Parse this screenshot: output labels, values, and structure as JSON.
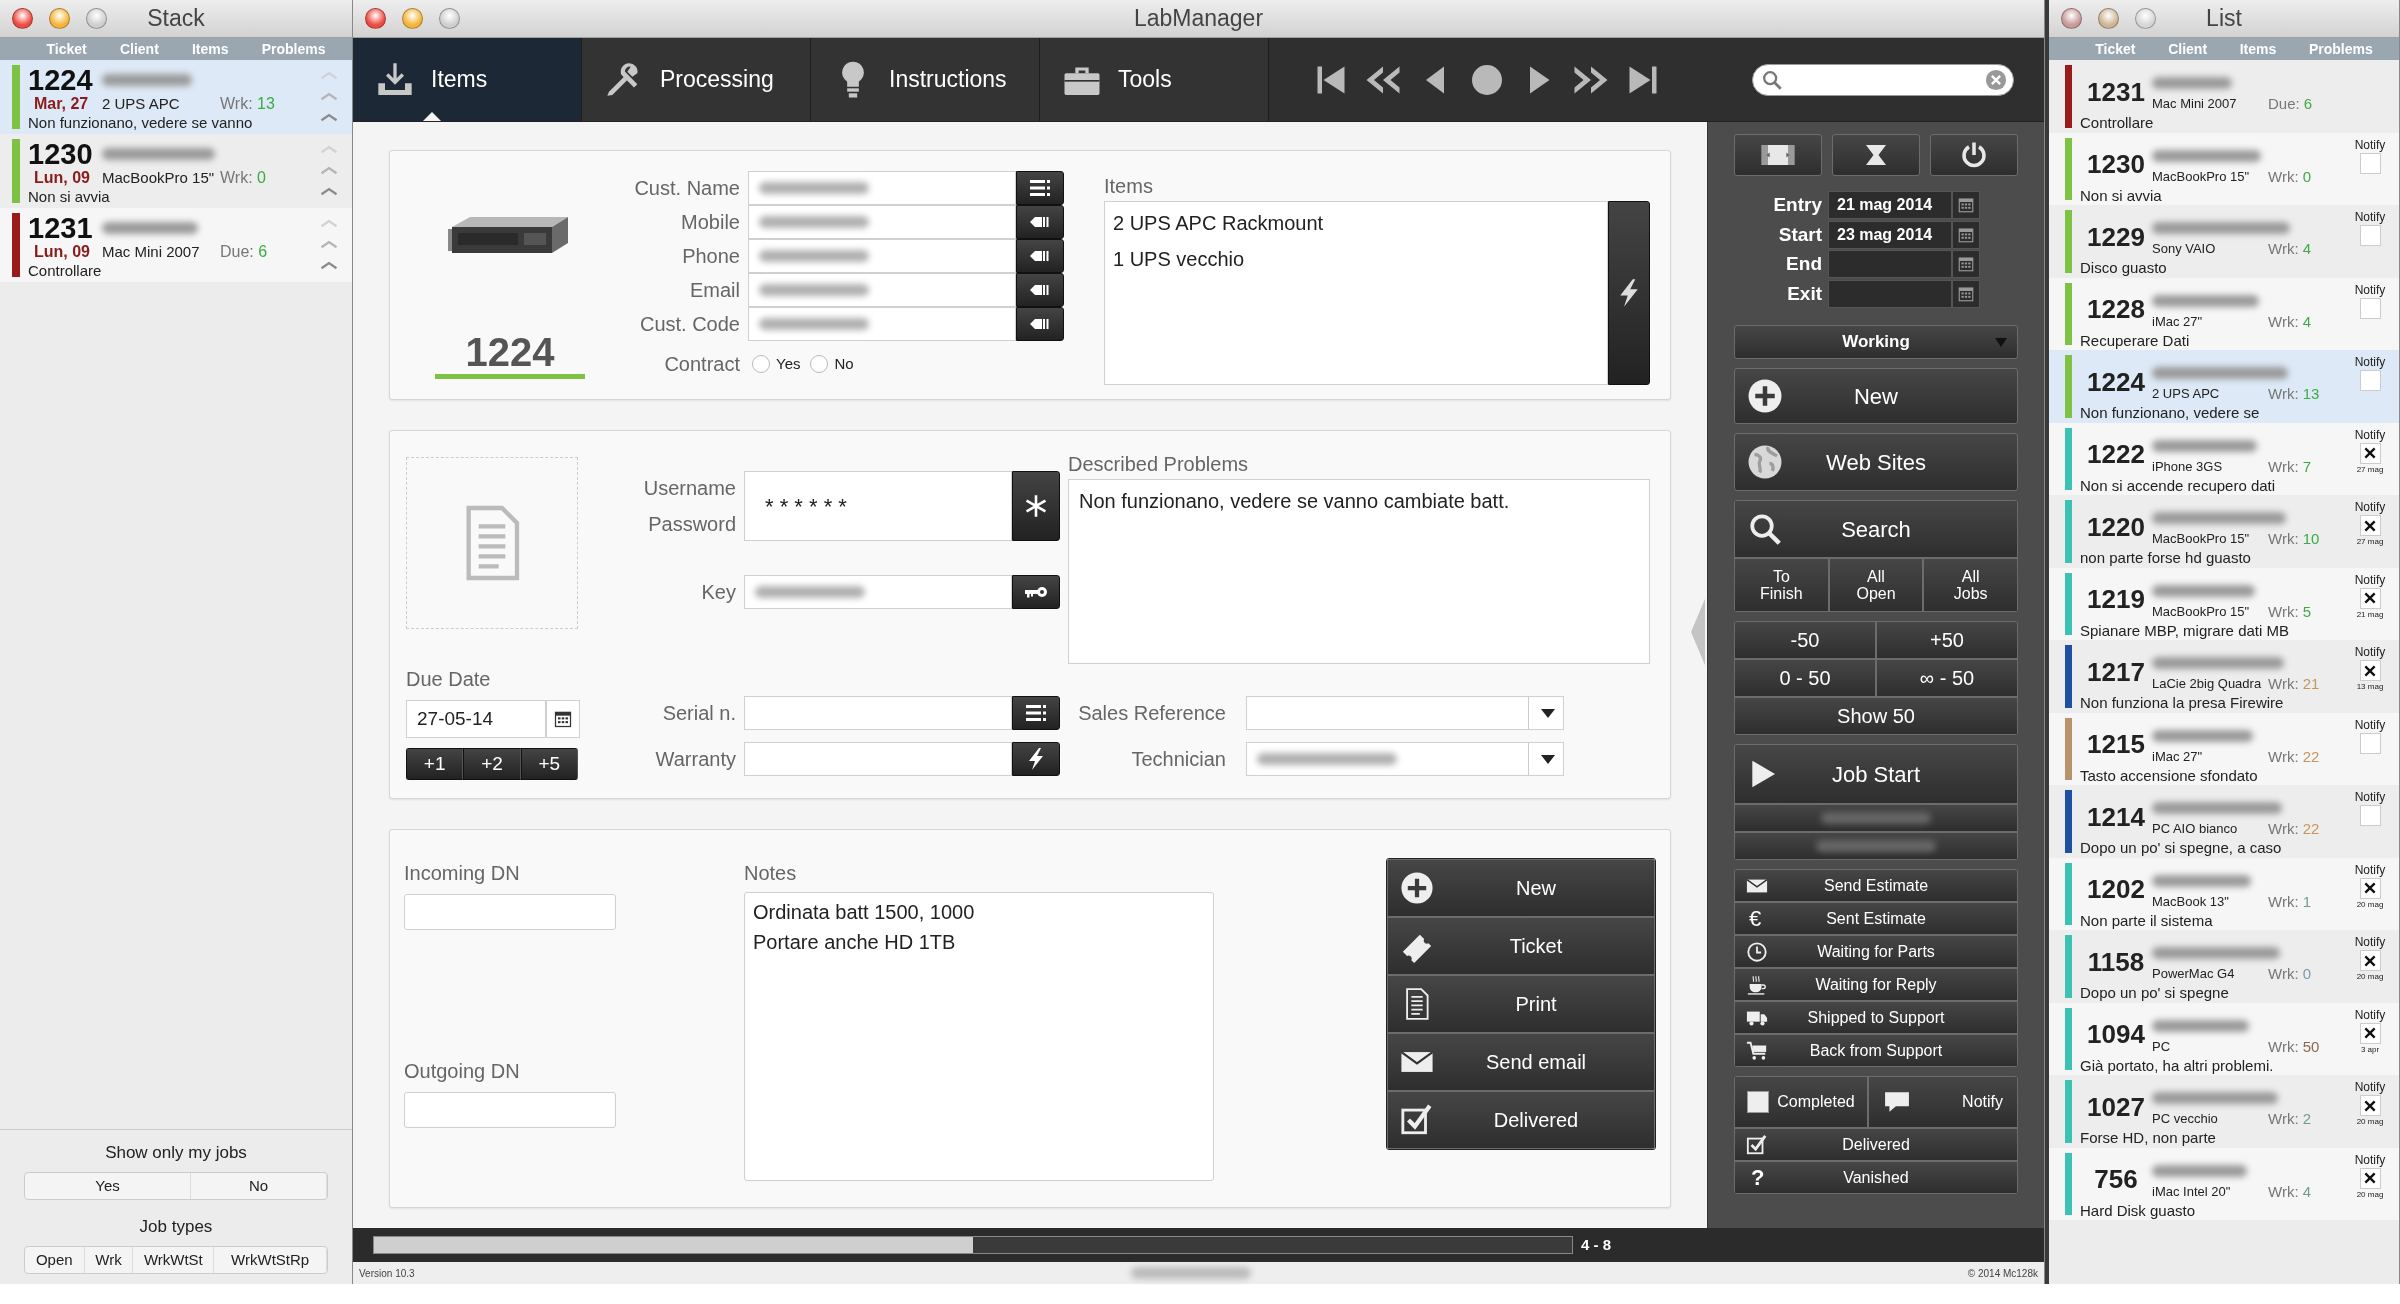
{
  "stack": {
    "title": "Stack",
    "columns": [
      "Ticket",
      "Client",
      "Items",
      "Problems"
    ],
    "rows": [
      {
        "ticket": "1224",
        "date": "Mar, 27",
        "client_redacted": true,
        "item": "2 UPS APC",
        "counter": {
          "label": "Wrk:",
          "value": "13",
          "color": "#3daa45"
        },
        "problem": "Non funzionano, vedere se vanno",
        "color": "#7dc242",
        "selected": true
      },
      {
        "ticket": "1230",
        "date": "Lun, 09",
        "client_redacted": true,
        "item": "MacBookPro 15\"",
        "counter": {
          "label": "Wrk:",
          "value": "0",
          "color": "#3daa45"
        },
        "problem": "Non si avvia",
        "color": "#7dc242",
        "selected": false
      },
      {
        "ticket": "1231",
        "date": "Lun, 09",
        "client_redacted": true,
        "item": "Mac Mini 2007",
        "counter": {
          "label": "Due:",
          "value": "6",
          "color": "#3daa45"
        },
        "problem": "Controllare",
        "color": "#9b1b1b",
        "selected": false
      }
    ],
    "my_jobs": {
      "label": "Show only my jobs",
      "options": [
        {
          "label": "Yes",
          "selected": false
        },
        {
          "label": "No",
          "selected": false
        }
      ]
    },
    "job_types": {
      "label": "Job types",
      "options": [
        {
          "label": "Open",
          "selected": false
        },
        {
          "label": "Wrk",
          "selected": false
        },
        {
          "label": "WrkWtSt",
          "selected": false
        },
        {
          "label": "WrkWtStRp",
          "selected": false
        }
      ]
    }
  },
  "main": {
    "title": "LabManager",
    "tabs": [
      {
        "label": "Items",
        "selected": true
      },
      {
        "label": "Processing",
        "selected": false
      },
      {
        "label": "Instructions",
        "selected": false
      },
      {
        "label": "Tools",
        "selected": false
      }
    ],
    "ticket": {
      "number": "1224",
      "color": "#7dc242"
    },
    "customer_fields": [
      {
        "label": "Cust. Name",
        "redacted": true
      },
      {
        "label": "Mobile",
        "redacted": true
      },
      {
        "label": "Phone",
        "redacted": true
      },
      {
        "label": "Email",
        "redacted": true
      },
      {
        "label": "Cust. Code",
        "redacted": true
      }
    ],
    "contract": {
      "label": "Contract",
      "options": [
        {
          "label": "Yes",
          "selected": false
        },
        {
          "label": "No",
          "selected": false
        }
      ]
    },
    "items": {
      "label": "Items",
      "lines": [
        "2 UPS APC Rackmount",
        "1 UPS vecchio"
      ]
    },
    "due_date": {
      "label": "Due Date",
      "value": "27-05-14",
      "increments": [
        "+1",
        "+2",
        "+5"
      ]
    },
    "credentials": {
      "labels": [
        "Username",
        "Password"
      ],
      "value": "* * * * * *"
    },
    "key": {
      "label": "Key",
      "redacted": true
    },
    "serial": {
      "label": "Serial n."
    },
    "warranty": {
      "label": "Warranty"
    },
    "described_problems": {
      "label": "Described Problems",
      "text": "Non funzionano, vedere se vanno cambiate batt."
    },
    "sales_reference": {
      "label": "Sales Reference"
    },
    "technician": {
      "label": "Technician",
      "redacted": true
    },
    "incoming_dn": {
      "label": "Incoming DN"
    },
    "outgoing_dn": {
      "label": "Outgoing DN"
    },
    "notes": {
      "label": "Notes",
      "lines": [
        "Ordinata batt 1500, 1000",
        "Portare anche HD 1TB"
      ]
    },
    "actions": [
      "New",
      "Ticket",
      "Print",
      "Send email",
      "Delivered"
    ],
    "dates": [
      {
        "label": "Entry",
        "value": "21 mag 2014"
      },
      {
        "label": "Start",
        "value": "23 mag 2014"
      },
      {
        "label": "End"
      },
      {
        "label": "Exit"
      }
    ],
    "status": "Working",
    "commands": [
      "New",
      "Web Sites",
      "Search"
    ],
    "filters": [
      "To Finish",
      "All Open",
      "All Jobs"
    ],
    "paging": [
      "-50",
      "+50",
      "0 - 50",
      "∞ - 50"
    ],
    "show": "Show 50",
    "job_start": "Job Start",
    "technicians": [
      {
        "redacted": true
      },
      {
        "redacted": true
      }
    ],
    "stages": [
      {
        "label": "Send Estimate"
      },
      {
        "label": "Sent Estimate",
        "glyph": "€"
      },
      {
        "label": "Waiting for Parts"
      },
      {
        "label": "Waiting for Reply"
      },
      {
        "label": "Shipped to Support"
      },
      {
        "label": "Back from Support"
      }
    ],
    "completed": {
      "label": "Completed",
      "checked": false
    },
    "notify": "Notify",
    "delivered": "Delivered",
    "vanished": {
      "label": "Vanished",
      "glyph": "?"
    },
    "progress": {
      "level": 0.5,
      "range": "4 - 8"
    },
    "version": "Version 10.3",
    "footer_redacted": true,
    "copyright": "© 2014 Mc128k"
  },
  "list": {
    "title": "List",
    "columns": [
      "Ticket",
      "Client",
      "Items",
      "Problems"
    ],
    "rows": [
      {
        "ticket": "1231",
        "client_redacted": true,
        "item": "Mac Mini 2007",
        "counter": {
          "label": "Due:",
          "value": "6",
          "color": "#3daa45"
        },
        "problem": "Controllare",
        "color": "#9b1b1b",
        "selected": false
      },
      {
        "ticket": "1230",
        "client_redacted": true,
        "item": "MacBookPro 15\"",
        "counter": {
          "label": "Wrk:",
          "value": "0",
          "color": "#3daa45"
        },
        "problem": "Non si avvia",
        "color": "#7dc242",
        "selected": false,
        "notify": {
          "label": "Notify",
          "checked": false
        }
      },
      {
        "ticket": "1229",
        "client_redacted": true,
        "item": "Sony VAIO",
        "counter": {
          "label": "Wrk:",
          "value": "4",
          "color": "#3daa45"
        },
        "problem": "Disco guasto",
        "color": "#7dc242",
        "selected": false,
        "notify": {
          "label": "Notify",
          "checked": false
        }
      },
      {
        "ticket": "1228",
        "client_redacted": true,
        "item": "iMac 27\"",
        "counter": {
          "label": "Wrk:",
          "value": "4",
          "color": "#3daa45"
        },
        "problem": "Recuperare Dati",
        "color": "#7dc242",
        "selected": false,
        "notify": {
          "label": "Notify",
          "checked": false
        }
      },
      {
        "ticket": "1224",
        "client_redacted": true,
        "item": "2 UPS APC",
        "counter": {
          "label": "Wrk:",
          "value": "13",
          "color": "#3daa45"
        },
        "problem": "Non funzionano, vedere se",
        "color": "#7dc242",
        "selected": true,
        "notify": {
          "label": "Notify",
          "checked": false
        }
      },
      {
        "ticket": "1222",
        "client_redacted": true,
        "item": "iPhone 3GS",
        "counter": {
          "label": "Wrk:",
          "value": "7",
          "color": "#3daa45"
        },
        "problem": "Non si accende recupero dati",
        "color": "#3cc1b5",
        "selected": false,
        "notify": {
          "label": "Notify",
          "checked": true,
          "date": "27 mag"
        }
      },
      {
        "ticket": "1220",
        "client_redacted": true,
        "item": "MacBookPro 15\"",
        "counter": {
          "label": "Wrk:",
          "value": "10",
          "color": "#3daa45"
        },
        "problem": "non parte forse hd guasto",
        "color": "#3cc1b5",
        "selected": false,
        "notify": {
          "label": "Notify",
          "checked": true,
          "date": "27 mag"
        }
      },
      {
        "ticket": "1219",
        "client_redacted": true,
        "item": "MacBookPro 15\"",
        "counter": {
          "label": "Wrk:",
          "value": "5",
          "color": "#3daa45"
        },
        "problem": "Spianare MBP, migrare dati MB",
        "color": "#3cc1b5",
        "selected": false,
        "notify": {
          "label": "Notify",
          "checked": true,
          "date": "21 mag"
        }
      },
      {
        "ticket": "1217",
        "client_redacted": true,
        "item": "LaCie 2big Quadra",
        "counter": {
          "label": "Wrk:",
          "value": "21",
          "color": "#c8955c"
        },
        "problem": "Non funziona la presa Firewire",
        "color": "#1d4fa3",
        "selected": false,
        "notify": {
          "label": "Notify",
          "checked": true,
          "date": "13 mag"
        }
      },
      {
        "ticket": "1215",
        "client_redacted": true,
        "item": "iMac 27\"",
        "counter": {
          "label": "Wrk:",
          "value": "22",
          "color": "#c8955c"
        },
        "problem": "Tasto accensione sfondato",
        "color": "#b8926a",
        "selected": false,
        "notify": {
          "label": "Notify",
          "checked": false
        }
      },
      {
        "ticket": "1214",
        "client_redacted": true,
        "item": "PC AIO bianco",
        "counter": {
          "label": "Wrk:",
          "value": "22",
          "color": "#c8955c"
        },
        "problem": "Dopo un po' si spegne, a caso",
        "color": "#1d4fa3",
        "selected": false,
        "notify": {
          "label": "Notify",
          "checked": false
        }
      },
      {
        "ticket": "1202",
        "client_redacted": true,
        "item": "MacBook 13\"",
        "counter": {
          "label": "Wrk:",
          "value": "1",
          "color": "#6f9c92"
        },
        "problem": "Non parte il sistema",
        "color": "#3cc1b5",
        "selected": false,
        "notify": {
          "label": "Notify",
          "checked": true,
          "date": "20 mag"
        }
      },
      {
        "ticket": "1158",
        "client_redacted": true,
        "item": "PowerMac G4",
        "counter": {
          "label": "Wrk:",
          "value": "0",
          "color": "#7a9aae"
        },
        "problem": "Dopo un po' si spegne",
        "color": "#3cc1b5",
        "selected": false,
        "notify": {
          "label": "Notify",
          "checked": true,
          "date": "20 mag"
        }
      },
      {
        "ticket": "1094",
        "client_redacted": true,
        "item": "PC",
        "counter": {
          "label": "Wrk:",
          "value": "50",
          "color": "#8a6a50"
        },
        "problem": "Già portato, ha altri problemi.",
        "color": "#3cc1b5",
        "selected": false,
        "notify": {
          "label": "Notify",
          "checked": true,
          "date": "3 apr"
        }
      },
      {
        "ticket": "1027",
        "client_redacted": true,
        "item": "PC vecchio",
        "counter": {
          "label": "Wrk:",
          "value": "2",
          "color": "#6f9c92"
        },
        "problem": "Forse HD, non parte",
        "color": "#3cc1b5",
        "selected": false,
        "notify": {
          "label": "Notify",
          "checked": true,
          "date": "20 mag"
        }
      },
      {
        "ticket": "756",
        "client_redacted": true,
        "item": "iMac Intel 20\"",
        "counter": {
          "label": "Wrk:",
          "value": "4",
          "color": "#6f9c92"
        },
        "problem": "Hard Disk guasto",
        "color": "#3cc1b5",
        "selected": false,
        "notify": {
          "label": "Notify",
          "checked": true,
          "date": "20 mag"
        }
      }
    ]
  }
}
